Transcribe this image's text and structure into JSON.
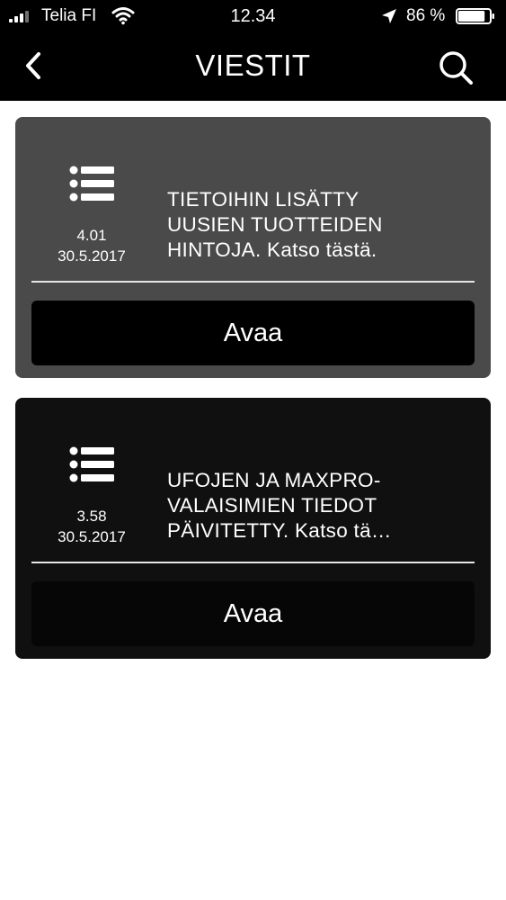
{
  "status_bar": {
    "carrier": "Telia FI",
    "time": "12.34",
    "battery_percent": "86 %",
    "battery_level": 0.86
  },
  "header": {
    "title": "VIESTIT",
    "back_icon": "chevron-left-icon",
    "search_icon": "search-icon"
  },
  "messages": [
    {
      "time": "4.01",
      "date": "30.5.2017",
      "text_lines": [
        "TIETOIHIN LISÄTTY",
        "UUSIEN TUOTTEIDEN",
        "HINTOJA. Katso tästä."
      ],
      "icon": "list-icon",
      "button_label": "Avaa",
      "card_color": "#4a4a4a"
    },
    {
      "time": "3.58",
      "date": "30.5.2017",
      "text_lines": [
        "UFOJEN JA MAXPRO-",
        "VALAISIMIEN TIEDOT",
        "PÄIVITETTY. Katso tä…"
      ],
      "icon": "list-icon",
      "button_label": "Avaa",
      "card_color": "#101010"
    }
  ],
  "colors": {
    "bar_background": "#000000",
    "page_background": "#ffffff",
    "text": "#ffffff"
  }
}
